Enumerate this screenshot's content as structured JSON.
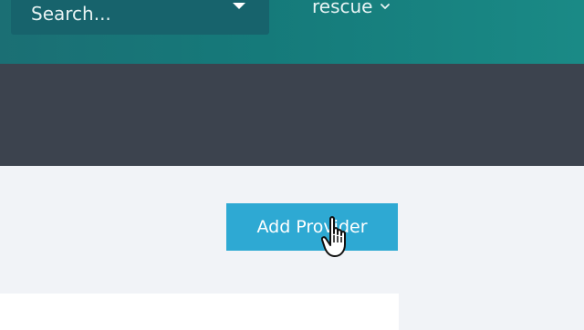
{
  "header": {
    "search_placeholder": "Search...",
    "nav_dropdown_label": "rescue"
  },
  "main": {
    "add_provider_label": "Add Provider"
  },
  "colors": {
    "topbar": "#157a7a",
    "darkbar": "#3c434e",
    "button": "#2ea9d3",
    "background": "#f1f3f7"
  },
  "icons": {
    "search_dropdown_caret": "caret-down-icon",
    "nav_chevron": "chevron-down-icon",
    "cursor": "hand-pointer-icon"
  }
}
